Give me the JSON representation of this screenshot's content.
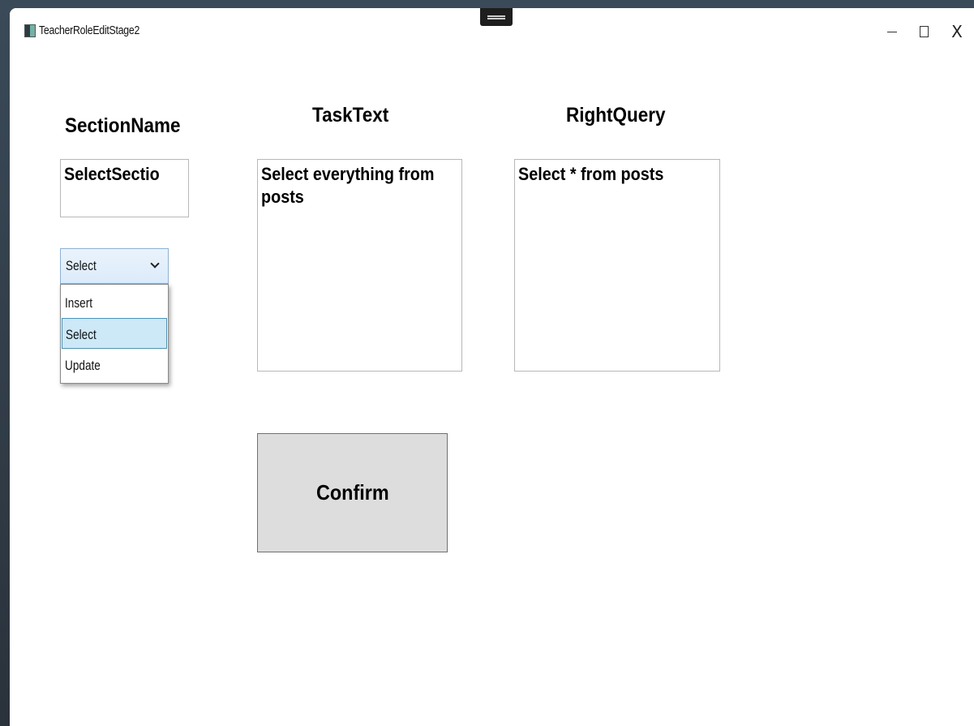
{
  "window": {
    "title": "TeacherRoleEditStage2",
    "controls": {
      "minimize_icon": "minimize-icon",
      "maximize_icon": "maximize-icon",
      "close_label": "X"
    }
  },
  "form": {
    "section_name": {
      "label": "SectionName",
      "value": "SelectSectio"
    },
    "task_text": {
      "label": "TaskText",
      "value": "Select everything from posts"
    },
    "right_query": {
      "label": "RightQuery",
      "value": "Select * from posts"
    },
    "section_type": {
      "selected": "Select",
      "options": [
        "Insert",
        "Select",
        "Update"
      ],
      "highlighted_index": 1,
      "expanded": true
    },
    "confirm_label": "Confirm"
  },
  "colors": {
    "combo_background": "#dcebfa",
    "combo_border": "#7eb4ea",
    "highlight_background": "#cde8f7",
    "highlight_border": "#26a0da",
    "button_background": "#dddddd"
  }
}
